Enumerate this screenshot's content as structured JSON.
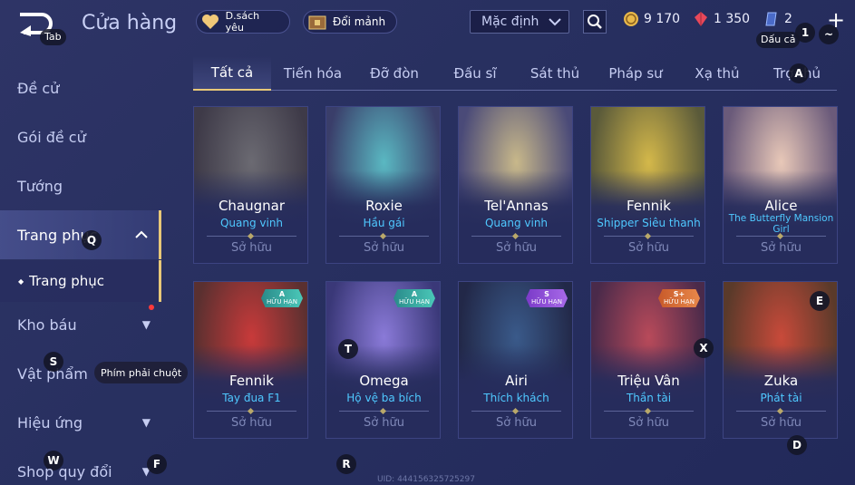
{
  "header": {
    "back_key": "Tab",
    "title": "Cửa hàng",
    "wishlist_label": "D.sách yêu",
    "exchange_label": "Đổi mảnh",
    "sort_value": "Mặc định",
    "currencies": [
      {
        "name": "gold-coin-icon",
        "value": "9 170"
      },
      {
        "name": "ruby-icon",
        "value": "1 350"
      },
      {
        "name": "voucher-icon",
        "value": "2"
      }
    ],
    "key_hint_1": "1",
    "key_hint_tilde": "~",
    "currency_hint": "Dấu cả"
  },
  "tabs": [
    "Tất cả",
    "Tiến hóa",
    "Đỡ đòn",
    "Đấu sĩ",
    "Sát thủ",
    "Pháp sư",
    "Xạ thủ",
    "Trợ thủ"
  ],
  "tab_key_hint": "A",
  "sidebar": {
    "items": [
      {
        "label": "Đề cử"
      },
      {
        "label": "Gói đề cử"
      },
      {
        "label": "Tướng"
      },
      {
        "label": "Trang phục"
      },
      {
        "label": "Kho báu"
      },
      {
        "label": "Vật phẩm"
      },
      {
        "label": "Hiệu ứng"
      },
      {
        "label": "Shop quy đổi"
      }
    ],
    "sub_item": "Trang phục",
    "key_q": "Q",
    "key_s": "S",
    "key_w": "W",
    "key_f": "F",
    "tooltip": "Phím phải chuột"
  },
  "cards": [
    {
      "name": "Chaugnar",
      "skin": "Quang vinh",
      "owned": "Sở hữu",
      "colors": [
        "#6b6a72",
        "#3e3a48"
      ]
    },
    {
      "name": "Roxie",
      "skin": "Hầu gái",
      "owned": "Sở hữu",
      "colors": [
        "#5ab8c2",
        "#3a3e6a"
      ]
    },
    {
      "name": "Tel'Annas",
      "skin": "Quang vinh",
      "owned": "Sở hữu",
      "colors": [
        "#c8b88a",
        "#4a4a78"
      ]
    },
    {
      "name": "Fennik",
      "skin": "Shipper Siêu thanh",
      "owned": "Sở hữu",
      "colors": [
        "#d4b84a",
        "#5a5a3a"
      ]
    },
    {
      "name": "Alice",
      "skin": "The Butterfly Mansion Girl",
      "owned": "Sở hữu",
      "colors": [
        "#e8c8b8",
        "#6a5a7a"
      ]
    },
    {
      "name": "Fennik",
      "skin": "Tay đua F1",
      "owned": "Sở hữu",
      "colors": [
        "#c83a3a",
        "#5a3030"
      ],
      "badge": "A",
      "badge_sub": "HỮU HẠN"
    },
    {
      "name": "Omega",
      "skin": "Hộ vệ ba bích",
      "owned": "Sở hữu",
      "colors": [
        "#8a7ad8",
        "#3a3878"
      ],
      "badge": "A",
      "badge_sub": "HỮU HẠN"
    },
    {
      "name": "Airi",
      "skin": "Thích khách",
      "owned": "Sở hữu",
      "colors": [
        "#3a5a8a",
        "#222848"
      ],
      "badge": "S",
      "badge_sub": "HỮU HẠN"
    },
    {
      "name": "Triệu Vân",
      "skin": "Thần tài",
      "owned": "Sở hữu",
      "colors": [
        "#b84a5a",
        "#4a2a4a"
      ],
      "badge": "S+",
      "badge_sub": "HỮU HẠN"
    },
    {
      "name": "Zuka",
      "skin": "Phát tài",
      "owned": "Sở hữu",
      "colors": [
        "#c84a3a",
        "#5a3a2a"
      ]
    }
  ],
  "card_keys": {
    "t": "T",
    "x": "X",
    "e": "E",
    "r": "R",
    "d": "D"
  },
  "uid": "UID: 444156325725297"
}
